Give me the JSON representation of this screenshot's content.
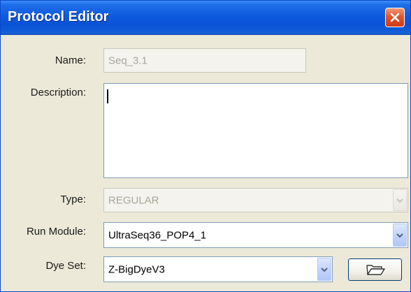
{
  "window": {
    "title": "Protocol Editor",
    "close_icon": "close-icon"
  },
  "form": {
    "name": {
      "label": "Name:",
      "value": "Seq_3.1",
      "enabled": false
    },
    "description": {
      "label": "Description:",
      "value": ""
    },
    "type": {
      "label": "Type:",
      "value": "REGULAR",
      "enabled": false
    },
    "run_module": {
      "label": "Run Module:",
      "value": "UltraSeq36_POP4_1"
    },
    "dye_set": {
      "label": "Dye Set:",
      "value": "Z-BigDyeV3",
      "browse_icon": "folder-open-icon"
    }
  },
  "colors": {
    "titlebar": "#0a52d6",
    "dialog_bg": "#ece9d8",
    "close_button": "#e2552d",
    "disabled_text": "#a9a79a"
  }
}
